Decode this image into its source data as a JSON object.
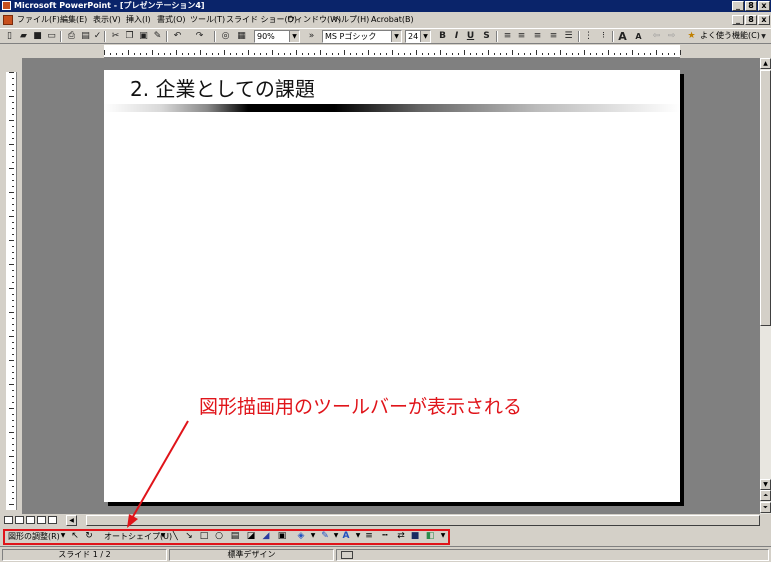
{
  "window": {
    "title": "Microsoft PowerPoint - [プレゼンテーション4]",
    "buttons": [
      "_",
      "8",
      "x"
    ]
  },
  "menubar": {
    "items": [
      "ファイル(F)",
      "編集(E)",
      "表示(V)",
      "挿入(I)",
      "書式(O)",
      "ツール(T)",
      "スライド ショー(D)",
      "ウィンドウ(W)",
      "ヘルプ(H)",
      "Acrobat(B)"
    ]
  },
  "toolbar": {
    "zoom": "90%",
    "font": "MS Pゴシック",
    "font_size": "24",
    "bold": "B",
    "italic": "I",
    "underline": "U",
    "shadow": "S",
    "increase_font": "A",
    "decrease_font": "A",
    "frequent_functions": "よく使う機能(C)"
  },
  "slide": {
    "title": "2. 企業としての課題"
  },
  "drawing_toolbar": {
    "draw_menu": "図形の調整(R)",
    "autoshapes_menu": "オートシェイプ(U)"
  },
  "statusbar": {
    "slide_indicator": "スライド 1 / 2",
    "design": "標準デザイン"
  },
  "annotation": {
    "text": "図形描画用のツールバーが表示される",
    "color": "#e0141a"
  },
  "colors": {
    "titlebar": "#0a246a",
    "chrome": "#d4d0c8",
    "workspace": "#808080",
    "highlight": "#e0141a"
  }
}
